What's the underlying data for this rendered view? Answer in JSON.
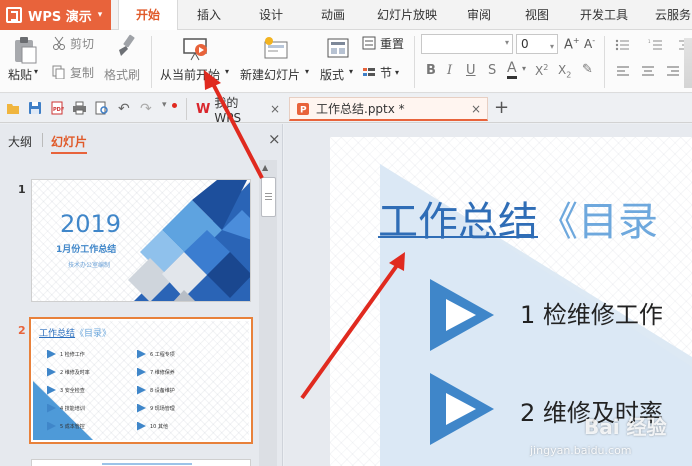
{
  "app": {
    "name": "WPS 演示"
  },
  "menu_tabs": [
    "开始",
    "插入",
    "设计",
    "动画",
    "幻灯片放映",
    "审阅",
    "视图",
    "开发工具",
    "云服务"
  ],
  "ribbon": {
    "paste": "粘贴",
    "cut": "剪切",
    "copy": "复制",
    "format_painter": "格式刷",
    "play_from_current": "从当前开始",
    "new_slide": "新建幻灯片",
    "layout": "版式",
    "reset": "重置",
    "section": "节",
    "font_size": "0",
    "font_name": ""
  },
  "doc_tabs": {
    "wps_tab": "我的WPS",
    "file_tab": "工作总结.pptx *",
    "new_tab_symbol": "+"
  },
  "panel": {
    "tab_outline": "大纲",
    "tab_slides": "幻灯片",
    "close": "×"
  },
  "thumbnails": {
    "slide1": {
      "number": "1",
      "year": "2019",
      "subtitle": "1月份工作总结",
      "caption": "技术办公室编制"
    },
    "slide2": {
      "number": "2",
      "title_main": "工作总结",
      "title_paren": "《目录》",
      "items_left": [
        "1 检修工作",
        "2 维修及时率",
        "3 安全检查",
        "4 技能培训",
        "5 成本管控"
      ],
      "items_right": [
        "6 工程专项",
        "7 维修保养",
        "8 设备维护",
        "9 现场管理",
        "10 其他"
      ]
    }
  },
  "slide": {
    "title_main": "工作总结",
    "title_paren": "《目录",
    "item1": "1 检维修工作",
    "item2": "2 维修及时率"
  },
  "watermark": "jingyan.baidu.com",
  "watermark_brand": "Bai 经验",
  "colors": {
    "accent": "#e8633b",
    "blue": "#3f7fc7",
    "arrow": "#e02a1f"
  }
}
